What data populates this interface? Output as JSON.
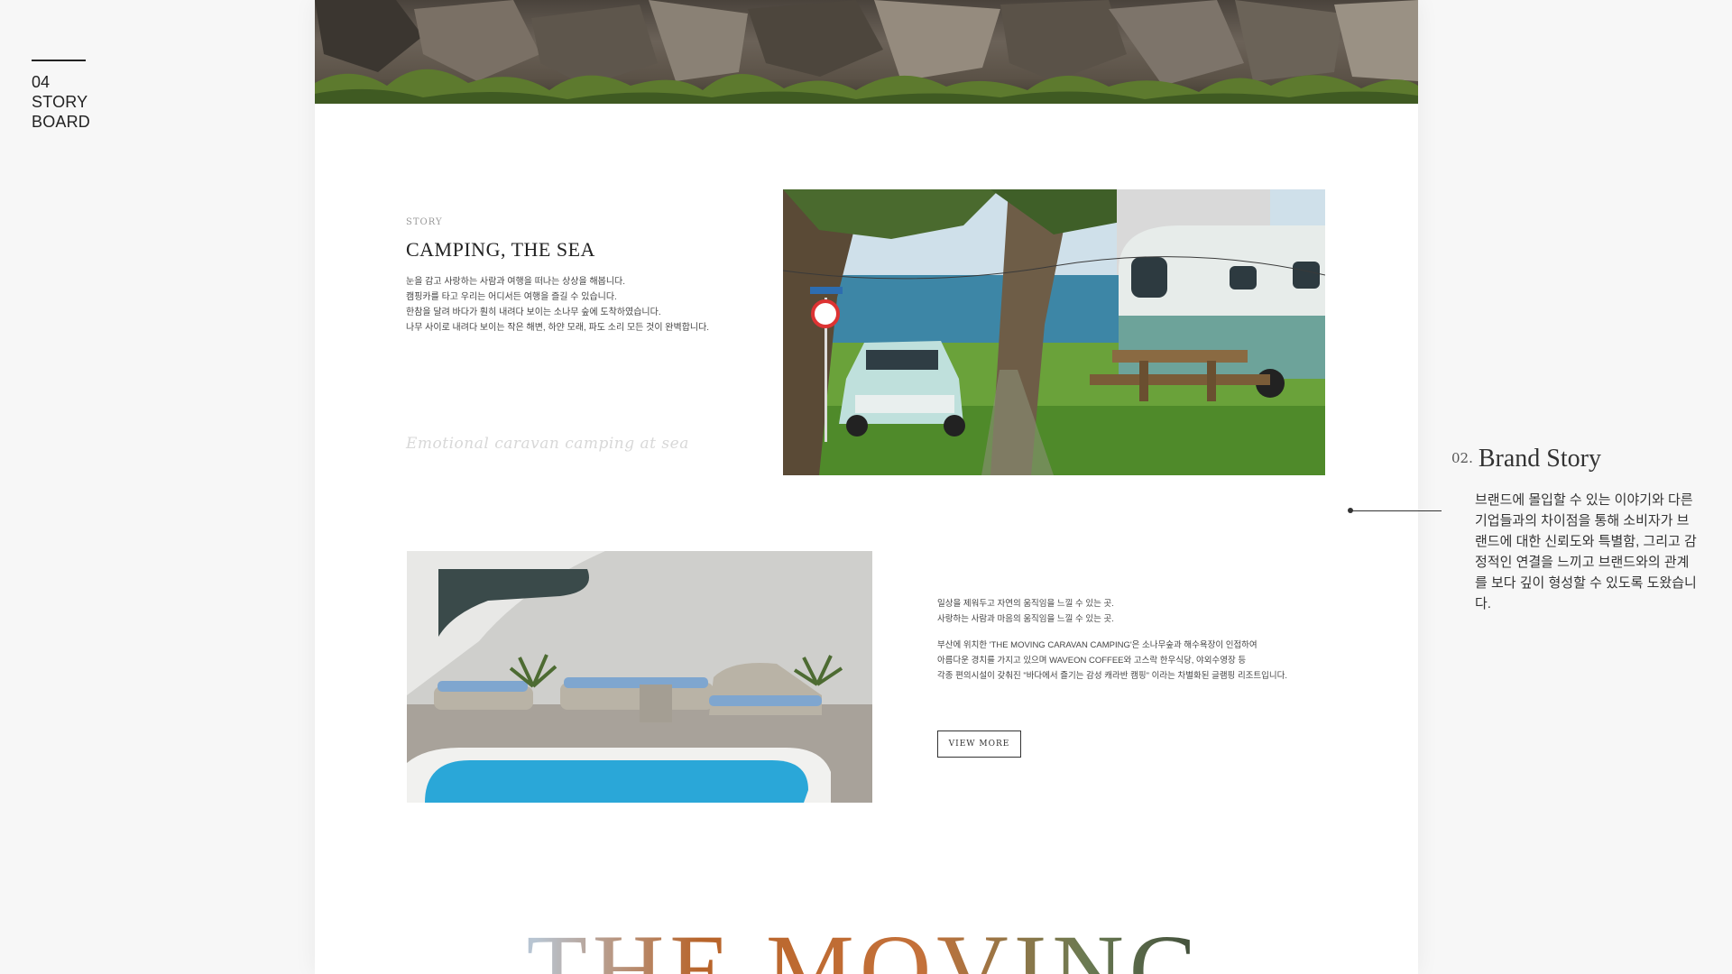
{
  "sidebar": {
    "number": "04",
    "line1": "STORY",
    "line2": "BOARD"
  },
  "story": {
    "kicker": "STORY",
    "title": "CAMPING, THE SEA",
    "body": [
      "눈을 감고 사랑하는 사람과 여행을 떠나는 상상을 해봅니다.",
      "캠핑카를 타고 우리는 어디서든 여행을 즐길 수 있습니다.",
      "한참을 달려 바다가 훤히 내려다 보이는 소나무 숲에 도착하였습니다.",
      "나무 사이로 내려다 보이는 작은 해변, 하얀 모래, 파도 소리 모든 것이 완벽합니다."
    ],
    "script": "Emotional caravan camping at sea"
  },
  "detail": {
    "para1": [
      "일상을 제워두고 자연의 움직임을 느낄 수 있는 곳.",
      "사랑하는 사람과 마음의 움직임을 느낄 수 있는 곳."
    ],
    "para2": [
      "부산에 위치한 'THE MOVING CARAVAN CAMPING'은 소나무숲과 해수욕장이 인접하여",
      "아름다운 경치를 가지고 있으며 WAVEON COFFEE와 고스락 한우식당, 야외수영장 등",
      "각종 편의시설이 갖춰진 \"바다에서 즐기는 감성 캐라반 캠핑\" 이라는 차별화된 글램핑 리조트입니다."
    ],
    "button": "VIEW MORE"
  },
  "footer_word": "THE MOVING",
  "annotation": {
    "number": "02.",
    "title": "Brand Story",
    "body": "브랜드에 몰입할 수 있는 이야기와 다른 기업들과의 차이점을 통해 소비자가 브랜드에 대한 신뢰도와 특별함, 그리고 감정적인 연결을 느끼고 브랜드와의 관계를 보다 깊이 형성할 수 있도록 도왔습니다."
  },
  "colors": {
    "accent_text": "#333333",
    "panel_bg": "#ffffff",
    "page_bg": "#f7f7f7",
    "pool": "#2aa7d8"
  }
}
